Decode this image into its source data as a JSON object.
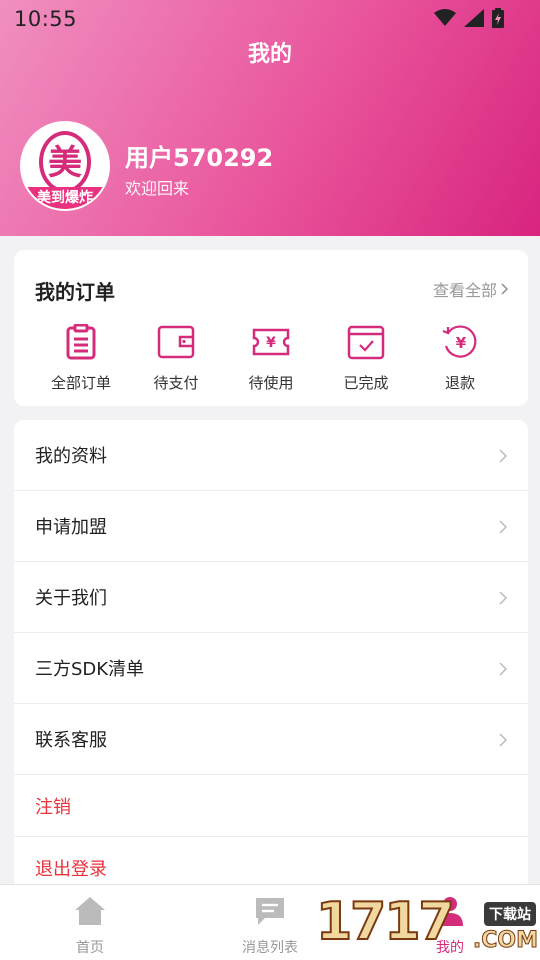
{
  "status": {
    "time": "10:55"
  },
  "header": {
    "title": "我的"
  },
  "user": {
    "name": "用户570292",
    "subtitle": "欢迎回来",
    "avatar_text": "美",
    "avatar_banner": "美到爆炸"
  },
  "orders": {
    "title": "我的订单",
    "view_all": "查看全部",
    "items": [
      {
        "label": "全部订单",
        "icon": "clipboard-icon"
      },
      {
        "label": "待支付",
        "icon": "wallet-icon"
      },
      {
        "label": "待使用",
        "icon": "ticket-icon"
      },
      {
        "label": "已完成",
        "icon": "calendar-check-icon"
      },
      {
        "label": "退款",
        "icon": "refund-yen-icon"
      }
    ]
  },
  "menu": [
    {
      "label": "我的资料"
    },
    {
      "label": "申请加盟"
    },
    {
      "label": "关于我们"
    },
    {
      "label": "三方SDK清单"
    },
    {
      "label": "联系客服"
    },
    {
      "label": "注销"
    },
    {
      "label": "退出登录"
    }
  ],
  "nav": [
    {
      "label": "首页",
      "icon": "home-icon"
    },
    {
      "label": "消息列表",
      "icon": "message-icon"
    },
    {
      "label": "我的",
      "icon": "profile-icon"
    }
  ],
  "watermark": {
    "text": "1717",
    "badge": "下载站",
    "domain": ".COM"
  },
  "colors": {
    "accent": "#d42c7b",
    "header_start": "#f08fc0",
    "header_end": "#d8247f",
    "danger": "#e8323c"
  }
}
